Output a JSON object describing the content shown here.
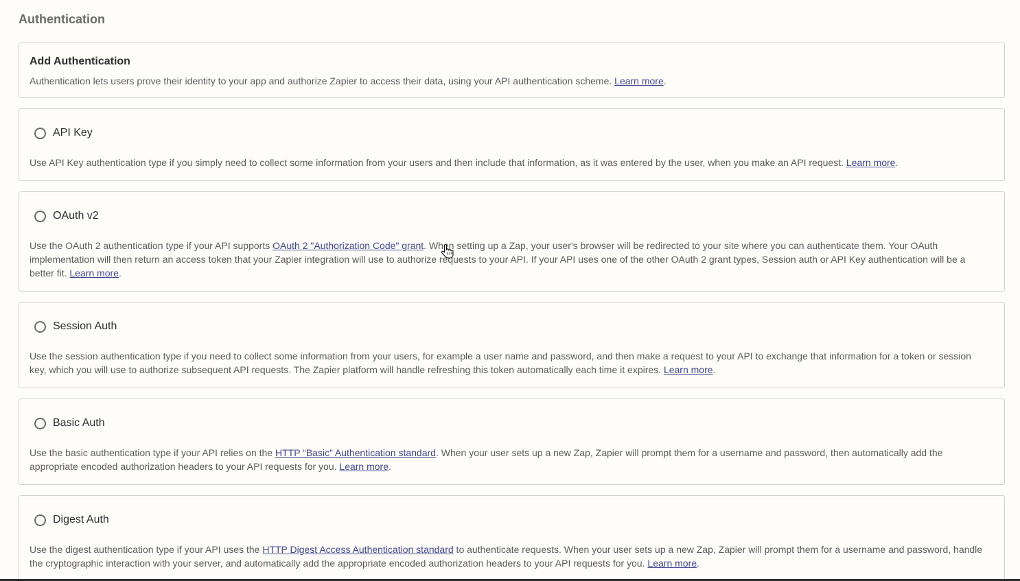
{
  "section_title": "Authentication",
  "intro": {
    "title": "Add Authentication",
    "text": "Authentication lets users prove their identity to your app and authorize Zapier to access their data, using your API authentication scheme.",
    "learn_more": "Learn more",
    "end": "."
  },
  "options": [
    {
      "label": "API Key",
      "text_before": "Use API Key authentication type if you simply need to collect some information from your users and then include that information, as it was entered by the user, when you make an API request.",
      "learn_more": "Learn more",
      "end": "."
    },
    {
      "label": "OAuth v2",
      "text_before": "Use the OAuth 2 authentication type if your API supports ",
      "inline_link": "OAuth 2 \"Authorization Code\" grant",
      "text_after": ". When setting up a Zap, your user's browser will be redirected to your site where you can authenticate them. Your OAuth implementation will then return an access token that your Zapier integration will use to authorize requests to your API. If your API uses one of the other OAuth 2 grant types, Session auth or API Key authentication will be a better fit.",
      "learn_more": "Learn more",
      "end": "."
    },
    {
      "label": "Session Auth",
      "text_before": "Use the session authentication type if you need to collect some information from your users, for example a user name and password, and then make a request to your API to exchange that information for a token or session key, which you will use to authorize subsequent API requests. The Zapier platform will handle refreshing this token automatically each time it expires.",
      "learn_more": "Learn more",
      "end": "."
    },
    {
      "label": "Basic Auth",
      "text_before": "Use the basic authentication type if your API relies on the ",
      "inline_link": "HTTP “Basic” Authentication standard",
      "text_after": ". When your user sets up a new Zap, Zapier will prompt them for a username and password, then automatically add the appropriate encoded authorization headers to your API requests for you.",
      "learn_more": "Learn more",
      "end": "."
    },
    {
      "label": "Digest Auth",
      "text_before": "Use the digest authentication type if your API uses the ",
      "inline_link": "HTTP Digest Access Authentication standard",
      "text_after": " to authenticate requests. When your user sets up a new Zap, Zapier will prompt them for a username and password, handle the cryptographic interaction with your server, and automatically add the appropriate encoded authorization headers to your API requests for you.",
      "learn_more": "Learn more",
      "end": "."
    }
  ],
  "colors": {
    "background": "#fffdf9",
    "border": "#d0cfcb",
    "link": "#3d4592",
    "text": "#5a5a5a",
    "heading": "#2d2e2e"
  },
  "icons": {
    "cursor": "hand-pointer-icon",
    "radio": "radio-unchecked-icon"
  }
}
